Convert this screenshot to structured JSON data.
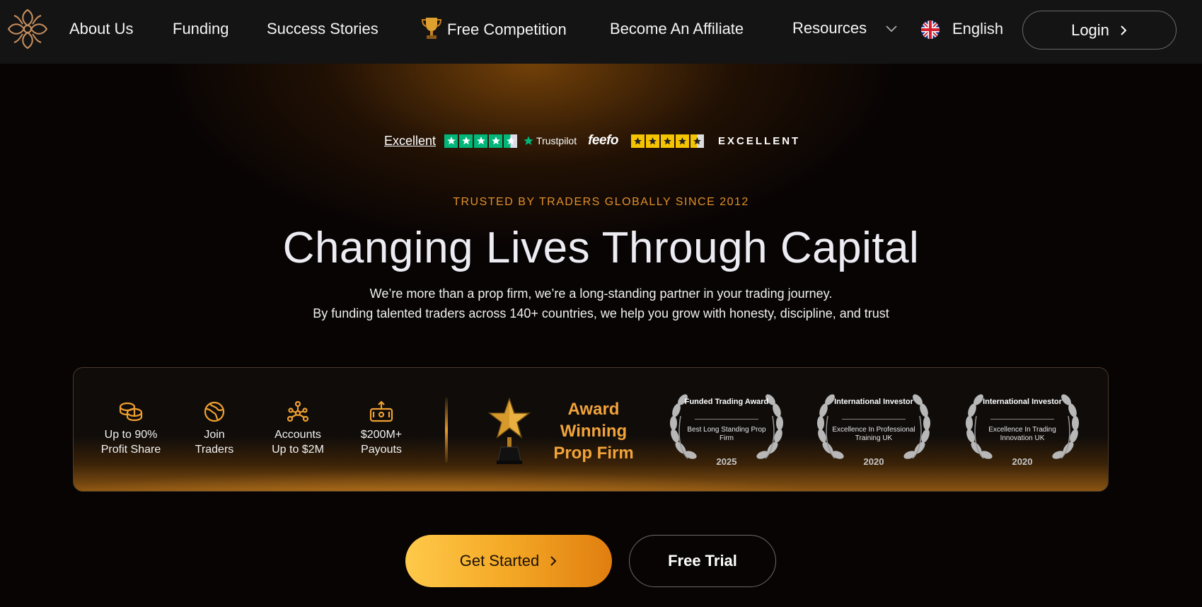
{
  "nav": {
    "about": "About Us",
    "funding": "Funding",
    "success": "Success Stories",
    "competition": "Free Competition",
    "affiliate": "Become An Affiliate",
    "resources": "Resources",
    "language": "English",
    "login": "Login"
  },
  "ratings": {
    "trustpilot_label": "Excellent",
    "trustpilot_brand": "Trustpilot",
    "trustpilot_stars": 4.5,
    "feefo_brand": "feefo",
    "feefo_stars": 4.5,
    "feefo_label": "EXCELLENT"
  },
  "hero": {
    "tagline": "TRUSTED BY TRADERS GLOBALLY SINCE 2012",
    "headline": "Changing Lives Through Capital",
    "sub1": "We’re more than a prop firm, we’re a long-standing partner in your trading journey.",
    "sub2": "By funding talented traders across 140+ countries, we help you grow with honesty, discipline, and trust"
  },
  "features": [
    {
      "line1": "Up to 90%",
      "line2": "Profit Share",
      "icon": "coins-icon"
    },
    {
      "line1": "Join",
      "line2": "Traders",
      "icon": "globe-icon"
    },
    {
      "line1": "Accounts",
      "line2": "Up to $2M",
      "icon": "network-icon"
    },
    {
      "line1": "$200M+",
      "line2": "Payouts",
      "icon": "payout-icon"
    }
  ],
  "award": {
    "line1": "Award",
    "line2": "Winning",
    "line3": "Prop Firm"
  },
  "laurels": [
    {
      "title": "Funded Trading Award",
      "desc": "Best Long Standing Prop Firm",
      "year": "2025"
    },
    {
      "title": "International Investor",
      "desc": "Excellence In Professional Training UK",
      "year": "2020"
    },
    {
      "title": "International Investor",
      "desc": "Excellence In Trading Innovation UK",
      "year": "2020"
    }
  ],
  "cta": {
    "start": "Get Started",
    "trial": "Free Trial"
  },
  "colors": {
    "accent": "#e0902a",
    "award": "#f2a33a",
    "trustpilot": "#00b67a",
    "feefo": "#f5c400"
  }
}
